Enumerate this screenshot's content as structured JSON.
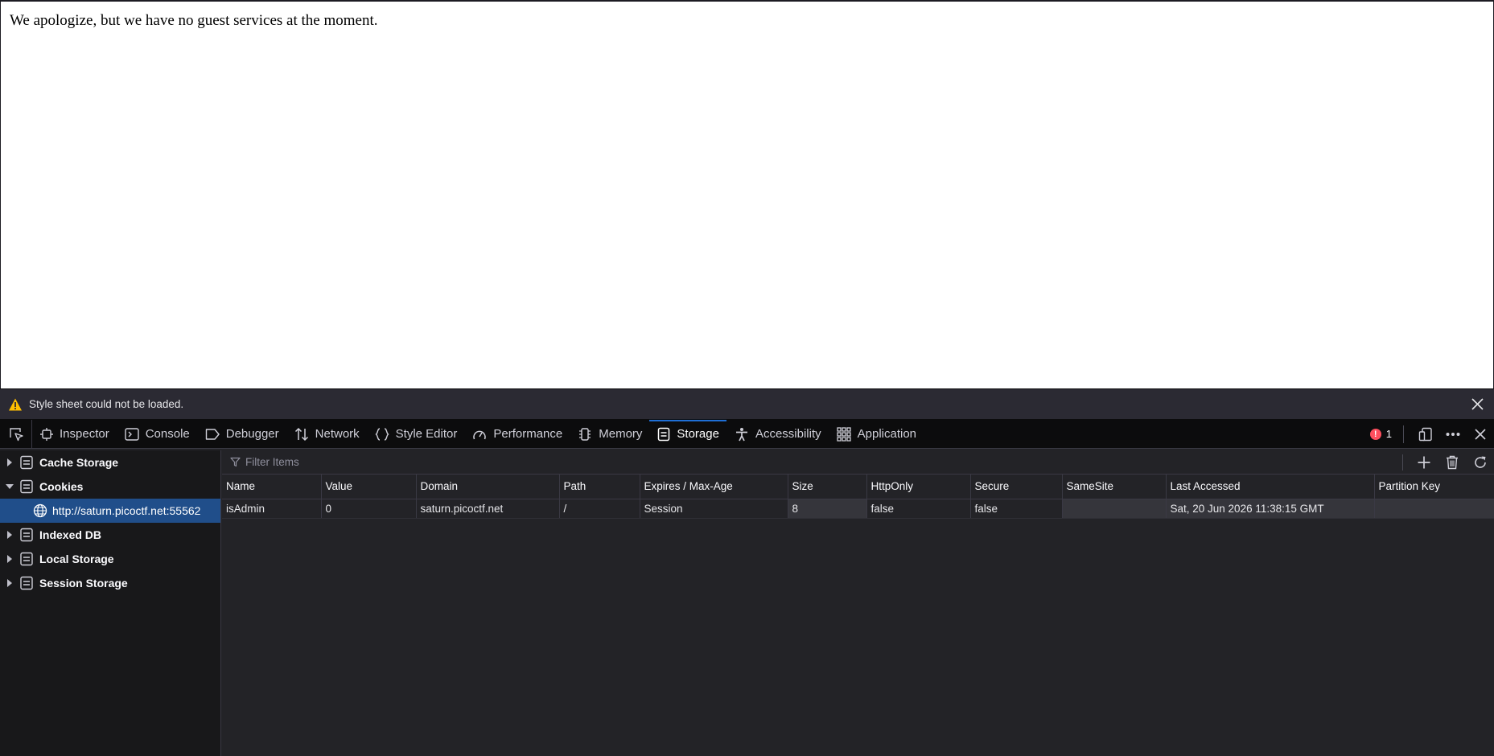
{
  "page": {
    "message": "We apologize, but we have no guest services at the moment."
  },
  "notice": {
    "text": "Style sheet could not be loaded."
  },
  "toolbar": {
    "tabs": [
      {
        "label": "Inspector",
        "icon": "inspector-icon"
      },
      {
        "label": "Console",
        "icon": "console-icon"
      },
      {
        "label": "Debugger",
        "icon": "debugger-icon"
      },
      {
        "label": "Network",
        "icon": "network-icon"
      },
      {
        "label": "Style Editor",
        "icon": "style-editor-icon"
      },
      {
        "label": "Performance",
        "icon": "performance-icon"
      },
      {
        "label": "Memory",
        "icon": "memory-icon"
      },
      {
        "label": "Storage",
        "icon": "storage-icon",
        "active": true
      },
      {
        "label": "Accessibility",
        "icon": "accessibility-icon"
      },
      {
        "label": "Application",
        "icon": "application-icon"
      }
    ],
    "error_count": "1",
    "error_count_color": "#ff4f5e",
    "accent": "#1f6fd6"
  },
  "sidebar": {
    "items": [
      {
        "label": "Cache Storage",
        "expanded": false
      },
      {
        "label": "Cookies",
        "expanded": true,
        "children": [
          {
            "label": "http://saturn.picoctf.net:55562",
            "selected": true
          }
        ]
      },
      {
        "label": "Indexed DB",
        "expanded": false
      },
      {
        "label": "Local Storage",
        "expanded": false
      },
      {
        "label": "Session Storage",
        "expanded": false
      }
    ],
    "selected_color": "#204e8a"
  },
  "filter": {
    "placeholder": "Filter Items"
  },
  "table": {
    "columns": [
      "Name",
      "Value",
      "Domain",
      "Path",
      "Expires / Max-Age",
      "Size",
      "HttpOnly",
      "Secure",
      "SameSite",
      "Last Accessed",
      "Partition Key"
    ],
    "rows": [
      [
        "isAdmin",
        "0",
        "saturn.picoctf.net",
        "/",
        "Session",
        "8",
        "false",
        "false",
        "",
        "Sat, 20 Jun 2026 11:38:15 GMT",
        ""
      ]
    ]
  }
}
